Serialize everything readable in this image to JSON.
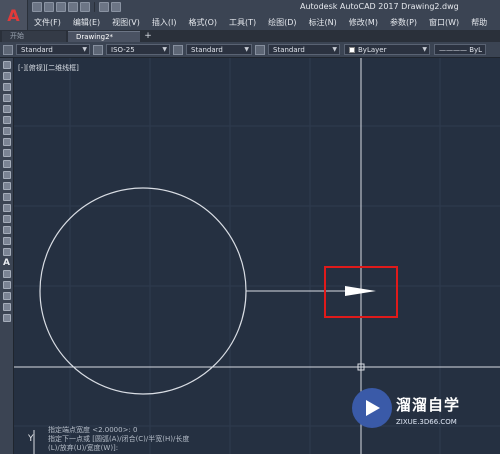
{
  "window": {
    "title": "Autodesk AutoCAD 2017    Drawing2.dwg",
    "app_logo": "A"
  },
  "menu": [
    "文件(F)",
    "编辑(E)",
    "视图(V)",
    "插入(I)",
    "格式(O)",
    "工具(T)",
    "绘图(D)",
    "标注(N)",
    "修改(M)",
    "参数(P)",
    "窗口(W)",
    "帮助"
  ],
  "tabs": {
    "home": "开始",
    "active": "Drawing2*",
    "add": "+"
  },
  "toolbar": {
    "text_style": "Standard",
    "dim_style": "ISO-25",
    "table_style": "Standard",
    "multileader_style": "Standard",
    "color": "ByLayer",
    "linetype": "———— ByL"
  },
  "viewport_label": "[-][俯视][二维线框]",
  "command": {
    "line1": "指定端点宽度 <2.0000>: 0",
    "line2": "指定下一点或 [圆弧(A)/闭合(C)/半宽(H)/长度",
    "line3": "(L)/放弃(U)/宽度(W)]:"
  },
  "ucs_label": "Y",
  "watermark": {
    "text": "溜溜自学",
    "url": "ZIXUE.3D66.COM"
  },
  "colors": {
    "canvas_bg": "#253041",
    "crosshair": "#d9dde4",
    "highlight_box": "#e01a1a",
    "drawing": "#d9dde4",
    "grid": "#2f3b4e"
  },
  "icons": [
    "new-icon",
    "open-icon",
    "save-icon",
    "saveas-icon",
    "print-icon",
    "undo-icon",
    "redo-icon"
  ]
}
